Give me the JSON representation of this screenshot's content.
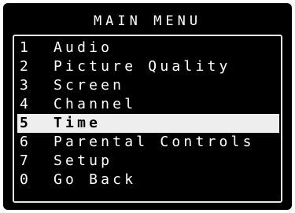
{
  "menu": {
    "title": "MAIN MENU",
    "selected_index": 4,
    "items": [
      {
        "number": "1",
        "label": "Audio"
      },
      {
        "number": "2",
        "label": "Picture Quality"
      },
      {
        "number": "3",
        "label": "Screen"
      },
      {
        "number": "4",
        "label": "Channel"
      },
      {
        "number": "5",
        "label": "Time"
      },
      {
        "number": "6",
        "label": "Parental Controls"
      },
      {
        "number": "7",
        "label": "Setup"
      },
      {
        "number": "0",
        "label": "Go Back"
      }
    ]
  },
  "colors": {
    "background": "#000000",
    "text": "#ffffff",
    "highlight": "#eeeeee",
    "highlight_text": "#000000"
  }
}
